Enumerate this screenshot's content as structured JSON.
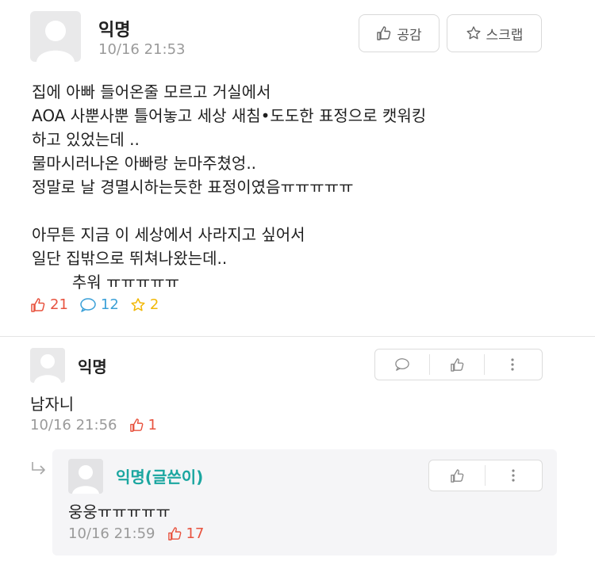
{
  "post": {
    "author": "익명",
    "timestamp": "10/16 21:53",
    "like_button": "공감",
    "scrap_button": "스크랩",
    "lines": [
      "집에 아빠 들어온줄 모르고 거실에서",
      "AOA 사뿐사뿐 틀어놓고 세상 새침•도도한 표정으로 캣워킹",
      "하고 있었는데 ..",
      "물마시러나온 아빠랑 눈마주쳤엉..",
      "정말로 날 경멸시하는듯한 표정이였음ㅠㅠㅠㅠㅠ",
      "",
      "아무튼 지금 이 세상에서 사라지고 싶어서",
      "일단 집밖으로 뛰쳐나왔는데..",
      "        추워 ㅠㅠㅠㅠㅠ"
    ],
    "likes": "21",
    "comments": "12",
    "scraps": "2"
  },
  "comment": {
    "author": "익명",
    "text": "남자니",
    "timestamp": "10/16 21:56",
    "likes": "1"
  },
  "reply": {
    "author": "익명(글쓴이)",
    "text": "웅웅ㅠㅠㅠㅠㅠ",
    "timestamp": "10/16 21:59",
    "likes": "17"
  },
  "colors": {
    "like_red": "#e8533f",
    "comment_blue": "#3aa0d8",
    "scrap_yellow": "#f2b807",
    "writer_teal": "#1aa6a0"
  },
  "icons": {
    "like": "thumbs-up-icon",
    "scrap": "star-icon",
    "comment": "speech-bubble-icon",
    "more": "vertical-dots-icon",
    "reply_arrow": "reply-arrow-icon"
  }
}
